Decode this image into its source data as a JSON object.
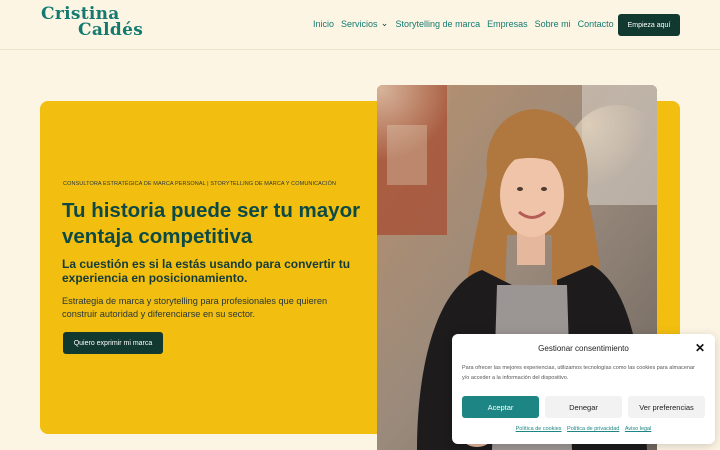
{
  "header": {
    "logo_line1": "Cristina",
    "logo_line2": "Caldés",
    "nav": {
      "items": [
        "Inicio",
        "Servicios",
        "Storytelling de marca",
        "Empresas",
        "Sobre mi",
        "Contacto"
      ]
    },
    "cta_label": "Empieza aquí"
  },
  "hero": {
    "eyebrow": "CONSULTORA ESTRATÉGICA DE MARCA PERSONAL | STORYTELLING DE MARCA  Y COMUNICACIÓN",
    "title": "Tu historia puede ser tu mayor ventaja competitiva",
    "subtitle": "La cuestión es si la estás usando para convertir tu experiencia en posicionamiento.",
    "description": "Estrategia de marca y storytelling para profesionales que quieren construir autoridad y diferenciarse en su sector.",
    "cta_label": "Quiero exprimir mi marca"
  },
  "consent": {
    "title": "Gestionar consentimiento",
    "text": "Para ofrecer las mejores experiencias, utilizamos tecnologías como las cookies para almacenar y/o acceder a la información del dispositivo.",
    "accept_label": "Aceptar",
    "deny_label": "Denegar",
    "preferences_label": "Ver preferencias",
    "links": [
      "Política de cookies",
      "Política de privacidad",
      "Aviso legal"
    ]
  },
  "colors": {
    "background": "#fdf5e4",
    "brand_teal": "#137a70",
    "dark_green": "#12392f",
    "yellow": "#f2be0f",
    "accept": "#1d8583"
  },
  "icons": {
    "dropdown": "chevron-down-icon",
    "close": "close-icon"
  }
}
